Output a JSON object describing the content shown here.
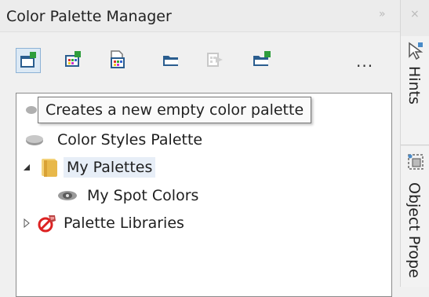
{
  "panel": {
    "title": "Color Palette Manager",
    "title_collapse_glyph": "»",
    "title_close_glyph": "×"
  },
  "toolbar": {
    "more_label": "...",
    "buttons": [
      {
        "icon": "new-palette-icon",
        "tooltip": "Creates a new empty color palette",
        "selected": true
      },
      {
        "icon": "new-palette-from-selection-icon"
      },
      {
        "icon": "new-palette-from-document-icon"
      },
      {
        "icon": "open-palette-icon"
      },
      {
        "icon": "export-palette-icon",
        "disabled": true
      },
      {
        "icon": "new-folder-icon"
      }
    ]
  },
  "tooltip": {
    "text": "Creates a new empty color palette"
  },
  "tree": {
    "items": [
      {
        "label": "Color Styles Palette",
        "icon": "palette-icon"
      },
      {
        "label": "My Palettes",
        "icon": "folder-icon",
        "expanded": true,
        "selected": true
      },
      {
        "label": "My Spot Colors",
        "icon": "eye-icon"
      },
      {
        "label": "Palette Libraries",
        "icon": "library-icon",
        "expanded": false
      }
    ]
  },
  "side_tabs": {
    "close_glyph": "×",
    "hints_label": "Hints",
    "object_props_label": "Object Prope"
  },
  "colors": {
    "folder_yellow": "#e8b84a",
    "accent_green": "#2e9d3c",
    "selection_bg": "#e7eef7",
    "toolbar_blue": "#2a5d8f"
  }
}
